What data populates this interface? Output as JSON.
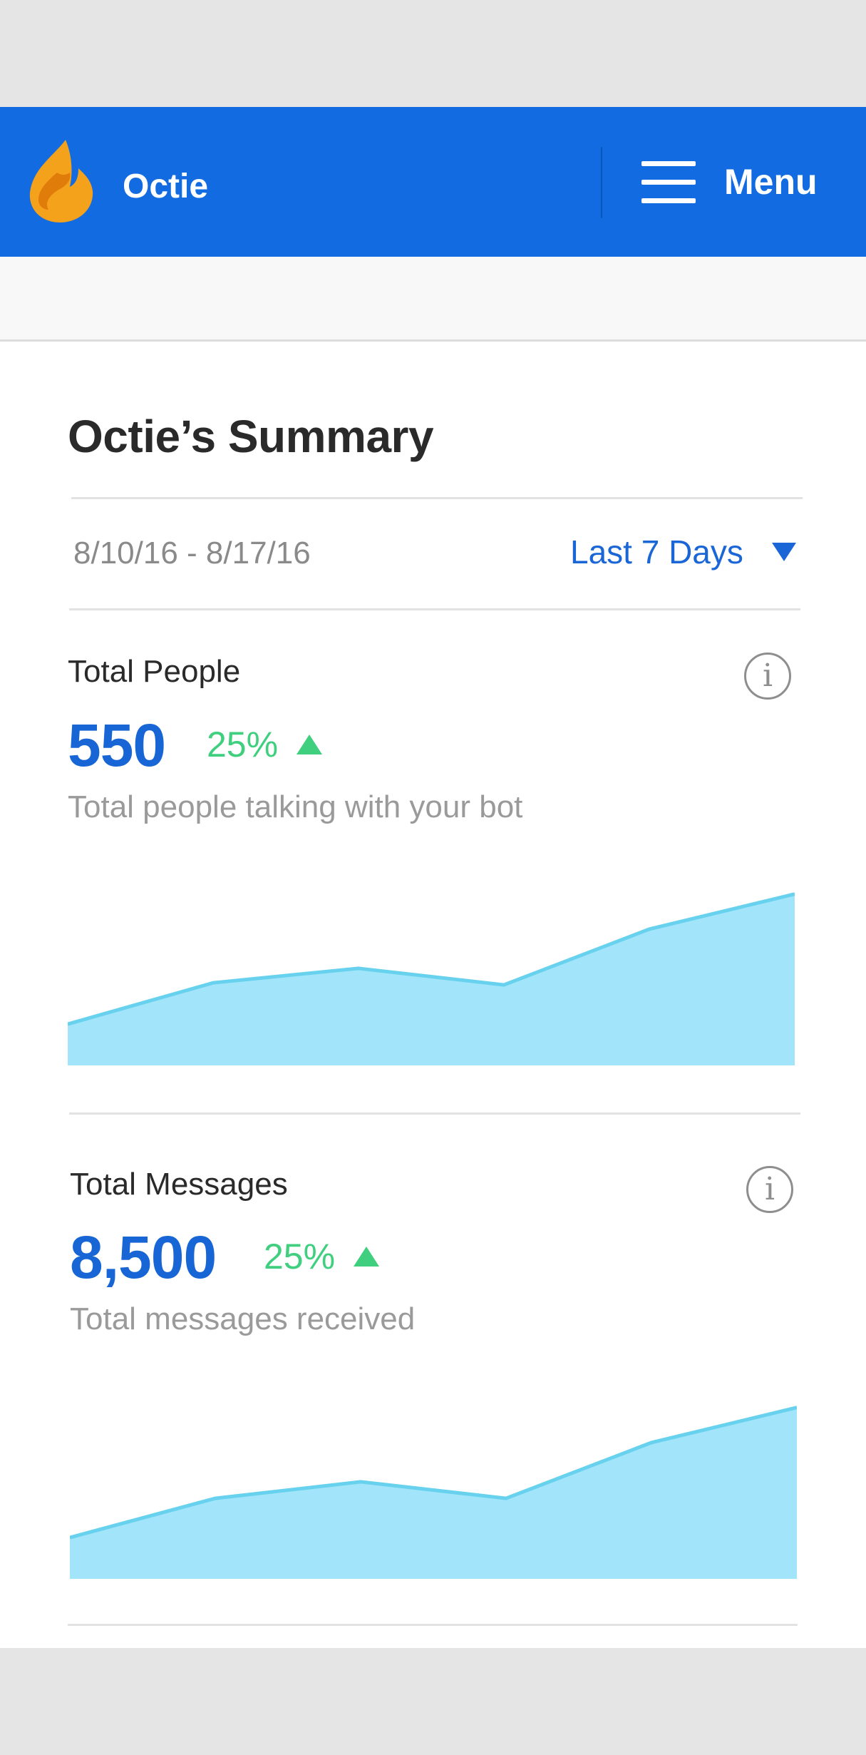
{
  "app": {
    "brand_name": "Octie",
    "menu_label": "Menu",
    "logo_icon": "flame-logo-icon",
    "accent_color": "#126be0"
  },
  "summary": {
    "title": "Octie’s Summary",
    "date_range": "8/10/16 - 8/17/16",
    "range_selector": "Last 7 Days"
  },
  "metrics": [
    {
      "label": "Total People",
      "value": "550",
      "change": "25%",
      "change_direction": "up",
      "description": "Total people talking with your bot",
      "info_icon": "info-icon"
    },
    {
      "label": "Total Messages",
      "value": "8,500",
      "change": "25%",
      "change_direction": "up",
      "description": "Total messages received",
      "info_icon": "info-icon"
    }
  ],
  "chart_data": [
    {
      "type": "area",
      "x": [
        1,
        2,
        3,
        4,
        5,
        6
      ],
      "values": [
        1.0,
        2.0,
        2.35,
        1.95,
        3.3,
        4.15
      ],
      "ylim": [
        0,
        4.3
      ],
      "grid": false,
      "fill_color": "#a2e4fa",
      "line_color": "#68d2ee"
    },
    {
      "type": "area",
      "x": [
        1,
        2,
        3,
        4,
        5,
        6
      ],
      "values": [
        1.0,
        1.95,
        2.35,
        1.95,
        3.3,
        4.15
      ],
      "ylim": [
        0,
        4.3
      ],
      "grid": false,
      "fill_color": "#a2e4fa",
      "line_color": "#68d2ee"
    }
  ]
}
